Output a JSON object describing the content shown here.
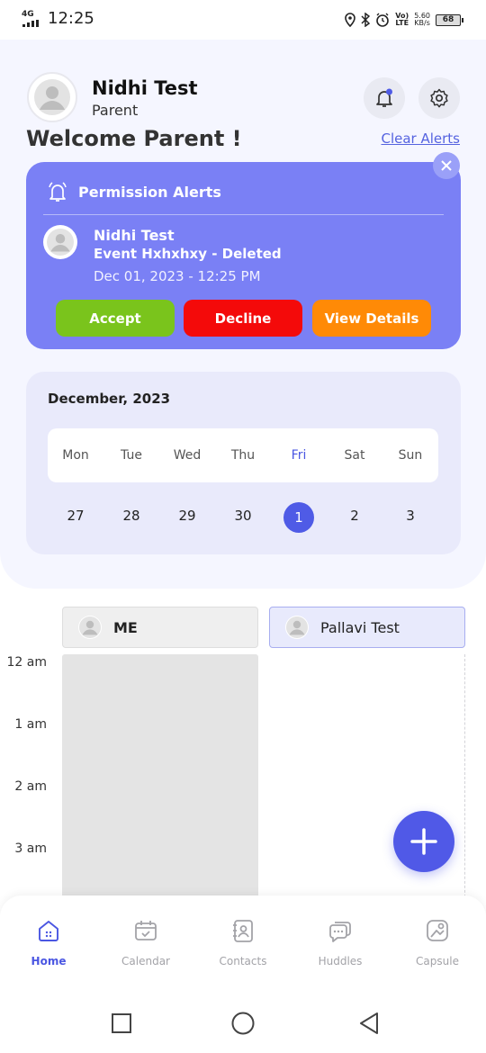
{
  "status_bar": {
    "network": "4G",
    "time": "12:25",
    "volte_top": "Vo)",
    "volte_bottom": "LTE",
    "speed_value": "5.60",
    "speed_unit": "KB/s",
    "battery": "68"
  },
  "profile": {
    "name": "Nidhi Test",
    "role": "Parent",
    "welcome": "Welcome Parent !",
    "clear_alerts": "Clear Alerts"
  },
  "alert": {
    "title": "Permission Alerts",
    "name": "Nidhi Test",
    "event": "Event Hxhxhxy - Deleted",
    "date": "Dec 01, 2023 - 12:25 PM",
    "accept": "Accept",
    "decline": "Decline",
    "view_details": "View Details",
    "colors": {
      "card": "#7a80f5",
      "accept": "#7ac41c",
      "decline": "#f40a0a",
      "details": "#ff8a06"
    }
  },
  "calendar": {
    "month": "December, 2023",
    "days": [
      "Mon",
      "Tue",
      "Wed",
      "Thu",
      "Fri",
      "Sat",
      "Sun"
    ],
    "dates": [
      "27",
      "28",
      "29",
      "30",
      "1",
      "2",
      "3"
    ],
    "selected_index": 4,
    "accent": "#4f5be6"
  },
  "schedule": {
    "columns": [
      {
        "label": "ME",
        "icon": "avatar-icon"
      },
      {
        "label": "Pallavi Test",
        "icon": "avatar-icon"
      }
    ],
    "times": [
      "12 am",
      "1 am",
      "2 am",
      "3 am"
    ]
  },
  "bottom_nav": {
    "items": [
      {
        "label": "Home",
        "icon": "home-icon",
        "active": true
      },
      {
        "label": "Calendar",
        "icon": "calendar-icon",
        "active": false
      },
      {
        "label": "Contacts",
        "icon": "contacts-icon",
        "active": false
      },
      {
        "label": "Huddles",
        "icon": "chat-icon",
        "active": false
      },
      {
        "label": "Capsule",
        "icon": "capsule-icon",
        "active": false
      }
    ]
  }
}
